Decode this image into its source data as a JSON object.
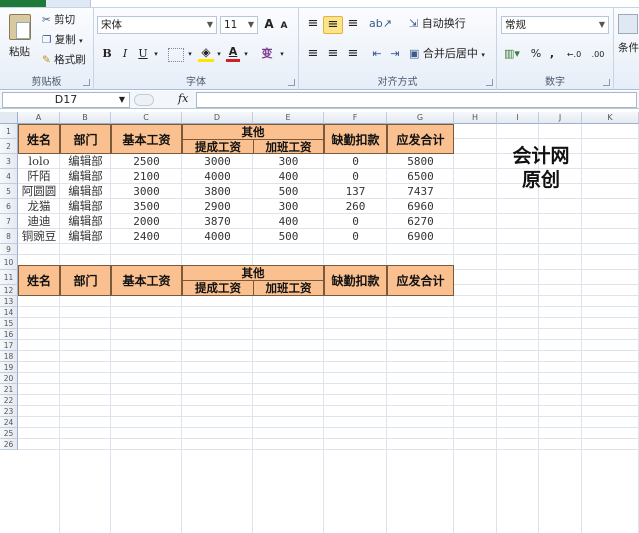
{
  "ribbon": {
    "clipboard": {
      "paste": "粘贴",
      "cut": "剪切",
      "copy": "复制",
      "format_painter": "格式刷",
      "label": "剪贴板"
    },
    "font": {
      "name": "宋体",
      "size": "11",
      "grow": "A",
      "shrink": "A",
      "bold": "B",
      "italic": "I",
      "underline": "U",
      "color_letter": "A",
      "phonetic": "变",
      "label": "字体"
    },
    "alignment": {
      "wrap_text": "自动换行",
      "merge_center": "合并后居中",
      "label": "对齐方式"
    },
    "number": {
      "format": "常规",
      "percent": "%",
      "comma": ",",
      "inc_decimal": "←.0",
      "dec_decimal": ".00",
      "label": "数字"
    },
    "styles": {
      "conditional": "条件"
    }
  },
  "formula_bar": {
    "name_box": "D17",
    "fx": "fx",
    "formula": ""
  },
  "columns": [
    "A",
    "B",
    "C",
    "D",
    "E",
    "F",
    "G",
    "H",
    "I",
    "J",
    "K"
  ],
  "rows": [
    "1",
    "2",
    "3",
    "4",
    "5",
    "6",
    "7",
    "8",
    "9",
    "10",
    "11",
    "12",
    "13",
    "14",
    "15",
    "16",
    "17",
    "18",
    "19",
    "20",
    "21",
    "22",
    "23",
    "24",
    "25",
    "26"
  ],
  "table1": {
    "headers": {
      "name": "姓名",
      "dept": "部门",
      "base": "基本工资",
      "other": "其他",
      "commission": "提成工资",
      "overtime": "加班工资",
      "deduction": "缺勤扣款",
      "total": "应发合计"
    },
    "rows": [
      [
        "lolo",
        "编辑部",
        "2500",
        "3000",
        "300",
        "0",
        "5800"
      ],
      [
        "阡陌",
        "编辑部",
        "2100",
        "4000",
        "400",
        "0",
        "6500"
      ],
      [
        "阿圆圆",
        "编辑部",
        "3000",
        "3800",
        "500",
        "137",
        "7437"
      ],
      [
        "龙猫",
        "编辑部",
        "3500",
        "2900",
        "300",
        "260",
        "6960"
      ],
      [
        "迪迪",
        "编辑部",
        "2000",
        "3870",
        "400",
        "0",
        "6270"
      ],
      [
        "铜豌豆",
        "编辑部",
        "2400",
        "4000",
        "500",
        "0",
        "6900"
      ]
    ]
  },
  "table2": {
    "headers": {
      "name": "姓名",
      "dept": "部门",
      "base": "基本工资",
      "other": "其他",
      "commission": "提成工资",
      "overtime": "加班工资",
      "deduction": "缺勤扣款",
      "total": "应发合计"
    }
  },
  "watermark": [
    "会计网",
    "原创"
  ],
  "colors": {
    "header_fill": "#fac08f",
    "header_border": "#7a5a3a",
    "ribbon_green": "#1f7a3a"
  }
}
